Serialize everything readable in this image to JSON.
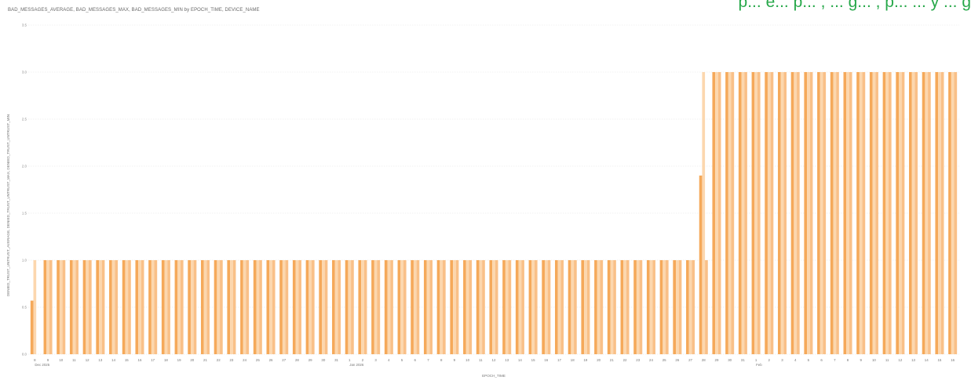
{
  "banner": {
    "text": "p...   e...  p...   ,   ...   g...   ,   p...   ...   y   ...   g"
  },
  "chart_data": {
    "type": "bar",
    "title": "BAD_MESSAGES_AVERAGE, BAD_MESSAGES_MAX, BAD_MESSAGES_MIN by EPOCH_TIME, DEVICE_NAME",
    "xlabel": "EPOCH_TIME",
    "ylabel": "DENIED_TRUST_UNTRUST_AVERAGE, DENIED_TRUST_UNTRUST_MAX, DENIED_TRUST_UNTRUST_MIN",
    "ylim": [
      0,
      3.5
    ],
    "yticks": [
      "0.0",
      "0.5",
      "1.0",
      "1.5",
      "2.0",
      "2.5",
      "3.0",
      "3.5"
    ],
    "grid": true,
    "categories": [
      "8",
      "9",
      "10",
      "11",
      "12",
      "13",
      "14",
      "15",
      "16",
      "17",
      "18",
      "19",
      "20",
      "21",
      "22",
      "23",
      "24",
      "25",
      "26",
      "27",
      "28",
      "29",
      "30",
      "31",
      "1",
      "2",
      "3",
      "4",
      "5",
      "6",
      "7",
      "8",
      "9",
      "10",
      "11",
      "12",
      "13",
      "14",
      "15",
      "16",
      "17",
      "18",
      "19",
      "20",
      "21",
      "22",
      "23",
      "24",
      "25",
      "26",
      "27",
      "28",
      "29",
      "30",
      "31",
      "1",
      "2",
      "3",
      "4",
      "5",
      "6",
      "7",
      "8",
      "9",
      "10",
      "11",
      "12",
      "13",
      "14",
      "15",
      "16"
    ],
    "month_labels": [
      {
        "index": 0,
        "label": "Dec 2025"
      },
      {
        "index": 24,
        "label": "Jan 2026"
      },
      {
        "index": 55,
        "label": "Feb"
      }
    ],
    "series": [
      {
        "values": [
          0.57,
          1,
          1,
          1,
          1,
          1,
          1,
          1,
          1,
          1,
          1,
          1,
          1,
          1,
          1,
          1,
          1,
          1,
          1,
          1,
          1,
          1,
          1,
          1,
          1,
          1,
          1,
          1,
          1,
          1,
          1,
          1,
          1,
          1,
          1,
          1,
          1,
          1,
          1,
          1,
          1,
          1,
          1,
          1,
          1,
          1,
          1,
          1,
          1,
          1,
          1,
          1.9,
          3,
          3,
          3,
          3,
          3,
          3,
          3,
          3,
          3,
          3,
          3,
          3,
          3,
          3,
          3,
          3,
          3,
          3,
          3
        ]
      },
      {
        "values": [
          1,
          1,
          1,
          1,
          1,
          1,
          1,
          1,
          1,
          1,
          1,
          1,
          1,
          1,
          1,
          1,
          1,
          1,
          1,
          1,
          1,
          1,
          1,
          1,
          1,
          1,
          1,
          1,
          1,
          1,
          1,
          1,
          1,
          1,
          1,
          1,
          1,
          1,
          1,
          1,
          1,
          1,
          1,
          1,
          1,
          1,
          1,
          1,
          1,
          1,
          1,
          3,
          3,
          3,
          3,
          3,
          3,
          3,
          3,
          3,
          3,
          3,
          3,
          3,
          3,
          3,
          3,
          3,
          3,
          3,
          3
        ]
      },
      {
        "values": [
          0,
          1,
          1,
          1,
          1,
          1,
          1,
          1,
          1,
          1,
          1,
          1,
          1,
          1,
          1,
          1,
          1,
          1,
          1,
          1,
          1,
          1,
          1,
          1,
          1,
          1,
          1,
          1,
          1,
          1,
          1,
          1,
          1,
          1,
          1,
          1,
          1,
          1,
          1,
          1,
          1,
          1,
          1,
          1,
          1,
          1,
          1,
          1,
          1,
          1,
          1,
          1,
          3,
          3,
          3,
          3,
          3,
          3,
          3,
          3,
          3,
          3,
          3,
          3,
          3,
          3,
          3,
          3,
          3,
          3,
          3
        ]
      }
    ],
    "colors": [
      "#f5a95a",
      "#fcd7ae",
      "#f9c088"
    ]
  }
}
